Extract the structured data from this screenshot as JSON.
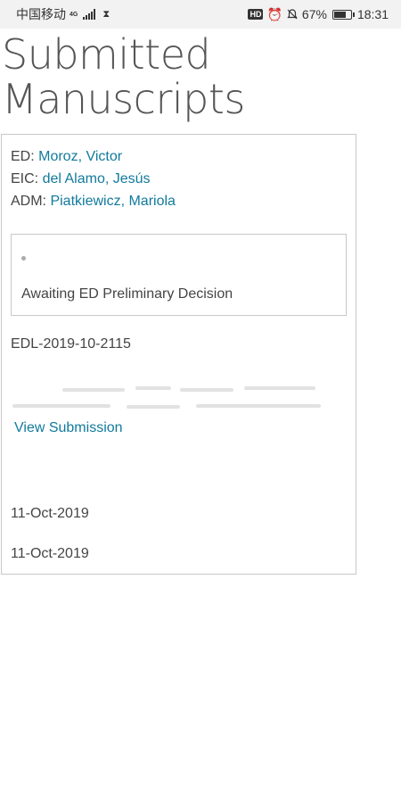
{
  "status_bar": {
    "carrier": "中国移动",
    "network": "4G",
    "battery_percent": "67%",
    "time": "18:31",
    "hd_label": "HD",
    "battery_level": 0.67
  },
  "page": {
    "title": "Submitted Manuscripts"
  },
  "manuscript": {
    "people": [
      {
        "role": "ED:",
        "name": "Moroz, Victor"
      },
      {
        "role": "EIC:",
        "name": "del Alamo, Jesús"
      },
      {
        "role": "ADM:",
        "name": "Piatkiewicz, Mariola"
      }
    ],
    "status": "Awaiting ED Preliminary Decision",
    "id": "EDL-2019-10-2115",
    "view_link": "View Submission",
    "submitted_date": "11-Oct-2019",
    "updated_date": "11-Oct-2019"
  },
  "colors": {
    "link": "#117a9c",
    "border": "#c8c8c8",
    "status_bar_bg": "#f2f2f2"
  }
}
